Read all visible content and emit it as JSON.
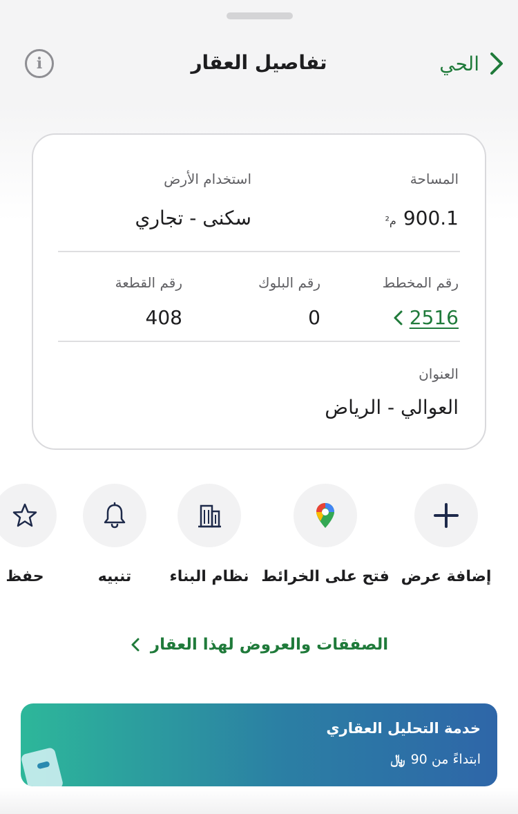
{
  "header": {
    "title": "تفاصيل العقار",
    "back_label": "الحي"
  },
  "details": {
    "area_label": "المساحة",
    "area_value": "900.1",
    "area_unit": "م²",
    "land_use_label": "استخدام الأرض",
    "land_use_value": "سكنى - تجاري",
    "plan_label": "رقم المخطط",
    "plan_value": "2516",
    "block_label": "رقم البلوك",
    "block_value": "0",
    "plot_label": "رقم القطعة",
    "plot_value": "408",
    "address_label": "العنوان",
    "address_value": "العوالي - الرياض"
  },
  "actions": [
    {
      "label": "إضافة عرض",
      "icon": "plus-icon"
    },
    {
      "label": "فتح على الخرائط",
      "icon": "map-pin-icon"
    },
    {
      "label": "نظام البناء",
      "icon": "building-icon"
    },
    {
      "label": "تنبيه",
      "icon": "bell-icon"
    },
    {
      "label": "حفظ",
      "icon": "star-icon"
    }
  ],
  "deals_link": "الصفقات والعروض لهذا العقار",
  "banner": {
    "title": "خدمة التحليل العقاري",
    "subtitle": "ابتداءً من 90",
    "currency": "﷼"
  },
  "colors": {
    "accent_green": "#1f7a3a",
    "icon_navy": "#1e2a4a",
    "banner_start": "#2db79a",
    "banner_end": "#2e66a8"
  }
}
